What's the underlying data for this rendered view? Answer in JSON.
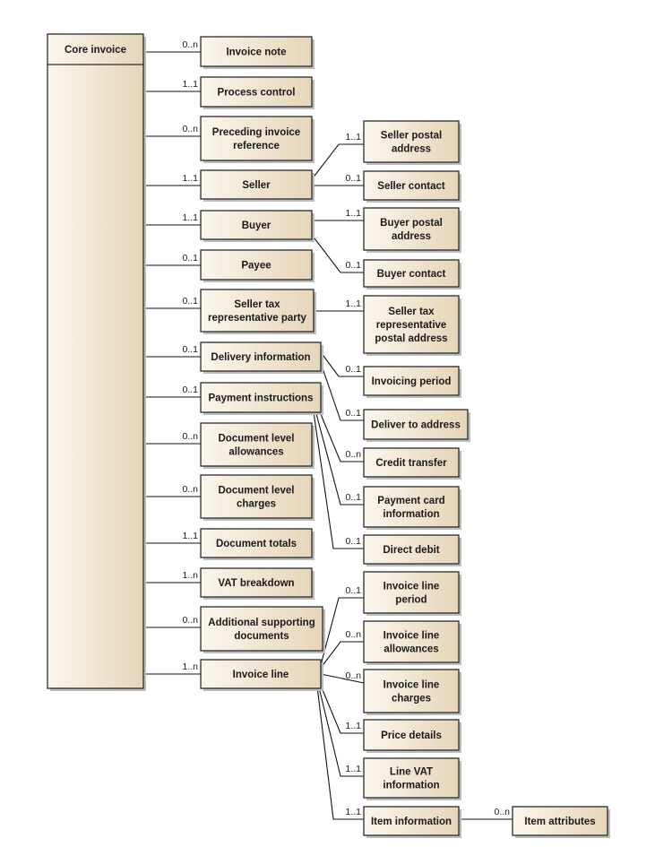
{
  "diagram": {
    "colors": {
      "box_fill_light": "#fbf6ec",
      "box_fill_dark": "#e6d5b8",
      "border": "#2a2a2a"
    },
    "classes": {
      "core": {
        "lines": [
          "Core invoice"
        ]
      },
      "invoice_note": {
        "lines": [
          "Invoice note"
        ]
      },
      "process_control": {
        "lines": [
          "Process control"
        ]
      },
      "preceding": {
        "lines": [
          "Preceding invoice",
          "reference"
        ]
      },
      "seller": {
        "lines": [
          "Seller"
        ]
      },
      "buyer": {
        "lines": [
          "Buyer"
        ]
      },
      "payee": {
        "lines": [
          "Payee"
        ]
      },
      "seller_tax": {
        "lines": [
          "Seller tax",
          "representative party"
        ]
      },
      "delivery": {
        "lines": [
          "Delivery information"
        ]
      },
      "payment": {
        "lines": [
          "Payment instructions"
        ]
      },
      "doc_allow": {
        "lines": [
          "Document level",
          "allowances"
        ]
      },
      "doc_charges": {
        "lines": [
          "Document level",
          "charges"
        ]
      },
      "doc_totals": {
        "lines": [
          "Document totals"
        ]
      },
      "vat": {
        "lines": [
          "VAT breakdown"
        ]
      },
      "additional": {
        "lines": [
          "Additional supporting",
          "documents"
        ]
      },
      "invoice_line": {
        "lines": [
          "Invoice line"
        ]
      },
      "seller_postal": {
        "lines": [
          "Seller postal",
          "address"
        ]
      },
      "seller_contact": {
        "lines": [
          "Seller contact"
        ]
      },
      "buyer_postal": {
        "lines": [
          "Buyer postal",
          "address"
        ]
      },
      "buyer_contact": {
        "lines": [
          "Buyer contact"
        ]
      },
      "seller_tax_postal": {
        "lines": [
          "Seller tax",
          "representative",
          "postal address"
        ]
      },
      "invoicing_period": {
        "lines": [
          "Invoicing period"
        ]
      },
      "deliver_to": {
        "lines": [
          "Deliver to address"
        ]
      },
      "credit_transfer": {
        "lines": [
          "Credit transfer"
        ]
      },
      "payment_card": {
        "lines": [
          "Payment card",
          "information"
        ]
      },
      "direct_debit": {
        "lines": [
          "Direct debit"
        ]
      },
      "line_period": {
        "lines": [
          "Invoice line",
          "period"
        ]
      },
      "line_allow": {
        "lines": [
          "Invoice line",
          "allowances"
        ]
      },
      "line_charges": {
        "lines": [
          "Invoice line",
          "charges"
        ]
      },
      "price_details": {
        "lines": [
          "Price details"
        ]
      },
      "line_vat": {
        "lines": [
          "Line VAT",
          "information"
        ]
      },
      "item_info": {
        "lines": [
          "Item information"
        ]
      },
      "item_attr": {
        "lines": [
          "Item attributes"
        ]
      }
    },
    "associations": [
      {
        "from": "core",
        "to": "invoice_note",
        "multiplicity": "0..n"
      },
      {
        "from": "core",
        "to": "process_control",
        "multiplicity": "1..1"
      },
      {
        "from": "core",
        "to": "preceding",
        "multiplicity": "0..n"
      },
      {
        "from": "core",
        "to": "seller",
        "multiplicity": "1..1"
      },
      {
        "from": "core",
        "to": "buyer",
        "multiplicity": "1..1"
      },
      {
        "from": "core",
        "to": "payee",
        "multiplicity": "0..1"
      },
      {
        "from": "core",
        "to": "seller_tax",
        "multiplicity": "0..1"
      },
      {
        "from": "core",
        "to": "delivery",
        "multiplicity": "0..1"
      },
      {
        "from": "core",
        "to": "payment",
        "multiplicity": "0..1"
      },
      {
        "from": "core",
        "to": "doc_allow",
        "multiplicity": "0..n"
      },
      {
        "from": "core",
        "to": "doc_charges",
        "multiplicity": "0..n"
      },
      {
        "from": "core",
        "to": "doc_totals",
        "multiplicity": "1..1"
      },
      {
        "from": "core",
        "to": "vat",
        "multiplicity": "1..n"
      },
      {
        "from": "core",
        "to": "additional",
        "multiplicity": "0..n"
      },
      {
        "from": "core",
        "to": "invoice_line",
        "multiplicity": "1..n"
      },
      {
        "from": "seller",
        "to": "seller_postal",
        "multiplicity": "1..1"
      },
      {
        "from": "seller",
        "to": "seller_contact",
        "multiplicity": "0..1"
      },
      {
        "from": "buyer",
        "to": "buyer_postal",
        "multiplicity": "1..1"
      },
      {
        "from": "buyer",
        "to": "buyer_contact",
        "multiplicity": "0..1"
      },
      {
        "from": "seller_tax",
        "to": "seller_tax_postal",
        "multiplicity": "1..1"
      },
      {
        "from": "delivery",
        "to": "invoicing_period",
        "multiplicity": "0..1"
      },
      {
        "from": "delivery",
        "to": "deliver_to",
        "multiplicity": "0..1"
      },
      {
        "from": "payment",
        "to": "credit_transfer",
        "multiplicity": "0..n"
      },
      {
        "from": "payment",
        "to": "payment_card",
        "multiplicity": "0..1"
      },
      {
        "from": "payment",
        "to": "direct_debit",
        "multiplicity": "0..1"
      },
      {
        "from": "invoice_line",
        "to": "line_period",
        "multiplicity": "0..1"
      },
      {
        "from": "invoice_line",
        "to": "line_allow",
        "multiplicity": "0..n"
      },
      {
        "from": "invoice_line",
        "to": "line_charges",
        "multiplicity": "0..n"
      },
      {
        "from": "invoice_line",
        "to": "price_details",
        "multiplicity": "1..1"
      },
      {
        "from": "invoice_line",
        "to": "line_vat",
        "multiplicity": "1..1"
      },
      {
        "from": "invoice_line",
        "to": "item_info",
        "multiplicity": "1..1"
      },
      {
        "from": "item_info",
        "to": "item_attr",
        "multiplicity": "0..n"
      }
    ]
  }
}
